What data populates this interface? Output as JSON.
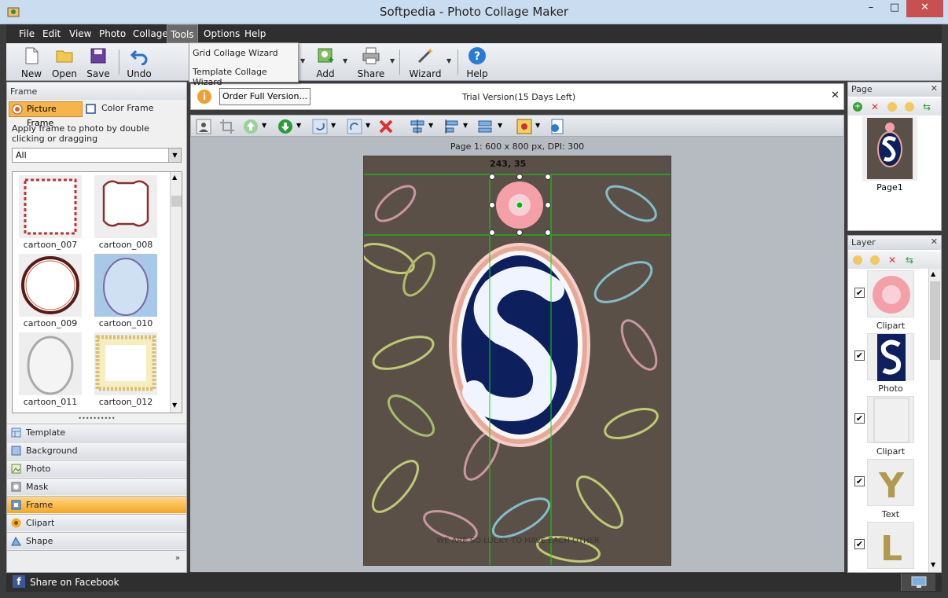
{
  "window": {
    "title": "Softpedia - Photo Collage Maker",
    "controls": [
      "–",
      "□",
      "✕"
    ]
  },
  "menu": [
    "File",
    "Edit",
    "View",
    "Photo",
    "Collage",
    "Tools",
    "Options",
    "Help"
  ],
  "tools_menu": [
    "Grid Collage Wizard",
    "Template Collage Wizard"
  ],
  "toolbar": {
    "new": "New",
    "open": "Open",
    "save": "Save",
    "undo": "Undo",
    "add": "Add",
    "share": "Share",
    "wizard": "Wizard",
    "help": "Help"
  },
  "left_panel": {
    "header": "Frame",
    "tab_picture": "Picture Frame",
    "tab_color": "Color Frame",
    "description": "Apply frame to photo by double clicking or dragging",
    "filter_value": "All",
    "thumbs": [
      "cartoon_007",
      "cartoon_008",
      "cartoon_009",
      "cartoon_010",
      "cartoon_011",
      "cartoon_012"
    ],
    "categories": [
      "Template",
      "Background",
      "Photo",
      "Mask",
      "Frame",
      "Clipart",
      "Shape"
    ],
    "active_category": "Frame"
  },
  "infobar": {
    "order_button": "Order Full Version...",
    "trial": "Trial Version(15 Days Left)"
  },
  "canvas": {
    "page_info": "Page 1: 600 x 800 px, DPI: 300",
    "coords": "243, 35",
    "bottom_text": "WE ARE SO LUCKY TO HAVE EACH OTHER"
  },
  "page_panel": {
    "title": "Page",
    "page_label": "Page1"
  },
  "layer_panel": {
    "title": "Layer",
    "layers": [
      {
        "label": "Clipart",
        "checked": true
      },
      {
        "label": "Photo",
        "checked": true
      },
      {
        "label": "Clipart",
        "checked": true
      },
      {
        "label": "Text",
        "checked": true
      },
      {
        "label": "",
        "checked": true
      }
    ]
  },
  "status": {
    "share_facebook": "Share on Facebook"
  },
  "colors": {
    "accent_orange": "#f5a623",
    "canvas_bg": "#5a5048",
    "egg_blue": "#0d1f5c",
    "guide_green": "#00e000"
  }
}
